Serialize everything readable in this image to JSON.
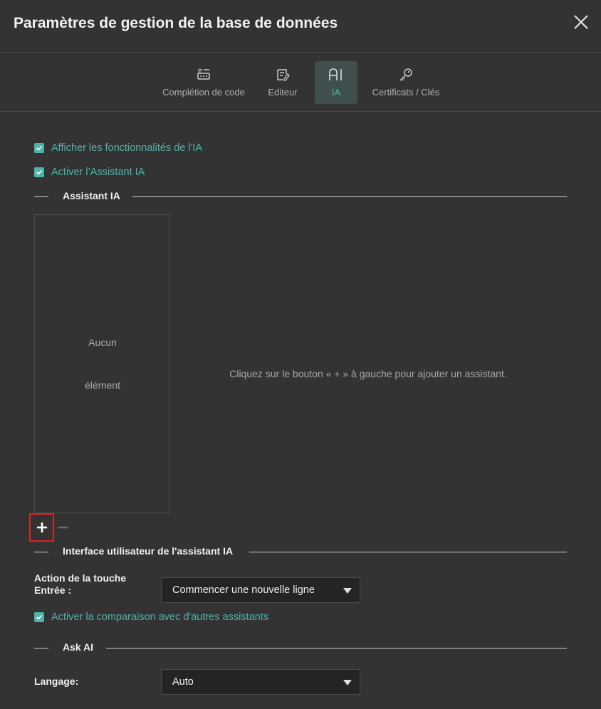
{
  "dialog": {
    "title": "Paramètres de gestion de la base de données"
  },
  "tabs": [
    {
      "label": "Complétion de code",
      "icon": "code-completion-icon",
      "active": false
    },
    {
      "label": "Editeur",
      "icon": "editor-icon",
      "active": false
    },
    {
      "label": "IA",
      "icon": "ai-icon",
      "active": true
    },
    {
      "label": "Certificats / Clés",
      "icon": "key-icon",
      "active": false
    }
  ],
  "settings": {
    "show_ai_features": {
      "label": "Afficher les fonctionnalités de l'IA",
      "checked": true
    },
    "enable_ai_assistant": {
      "label": "Activer l’Assistant IA",
      "checked": true
    }
  },
  "assistant_section": {
    "title": "Assistant IA",
    "empty_line1": "Aucun",
    "empty_line2": "élément",
    "hint": "Cliquez sur le bouton « + » à gauche pour ajouter un assistant.",
    "add_label": "+",
    "remove_label": "−"
  },
  "ui_section": {
    "title": "Interface utilisateur de l'assistant IA",
    "enter_action_label_1": "Action de la touche",
    "enter_action_label_2": "Entrée :",
    "enter_action_value": "Commencer une nouvelle ligne",
    "compare": {
      "label": "Activer la comparaison avec d'autres assistants",
      "checked": true
    }
  },
  "ask_ai_section": {
    "title": "Ask AI",
    "language_label": "Langage:",
    "language_value": "Auto"
  },
  "colors": {
    "background": "#333333",
    "accent": "#4fb3a9",
    "active_tab_bg": "#3f4f4d",
    "highlight_border": "#e02020"
  }
}
